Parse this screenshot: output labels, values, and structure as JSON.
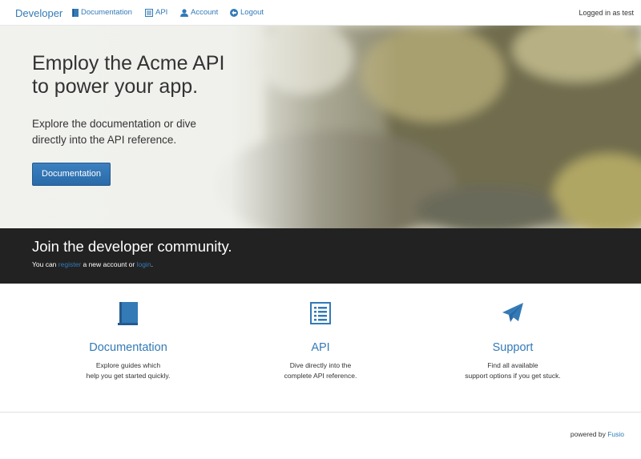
{
  "navbar": {
    "brand": "Developer",
    "items": [
      {
        "label": "Documentation",
        "icon": "book-icon"
      },
      {
        "label": "API",
        "icon": "list-icon"
      },
      {
        "label": "Account",
        "icon": "user-icon"
      },
      {
        "label": "Logout",
        "icon": "logout-icon"
      }
    ],
    "logged_in": "Logged in as test"
  },
  "hero": {
    "title_line1": "Employ the Acme API",
    "title_line2": "to power your app.",
    "text_line1": "Explore the documentation or dive",
    "text_line2": "directly into the API reference.",
    "button": "Documentation"
  },
  "community": {
    "title": "Join the developer community.",
    "text_prefix": "You can ",
    "register_link": "register",
    "text_middle": " a new account or ",
    "login_link": "login",
    "text_suffix": "."
  },
  "features": [
    {
      "title": "Documentation",
      "desc_line1": "Explore guides which",
      "desc_line2": "help you get started quickly.",
      "icon": "book-icon"
    },
    {
      "title": "API",
      "desc_line1": "Dive directly into the",
      "desc_line2": "complete API reference.",
      "icon": "list-icon"
    },
    {
      "title": "Support",
      "desc_line1": "Find all available",
      "desc_line2": "support options if you get stuck.",
      "icon": "paper-plane-icon"
    }
  ],
  "footer": {
    "prefix": "powered by ",
    "link": "Fusio"
  },
  "colors": {
    "link": "#337ab7",
    "community_bg": "#222222",
    "button": "#2f70ae"
  }
}
